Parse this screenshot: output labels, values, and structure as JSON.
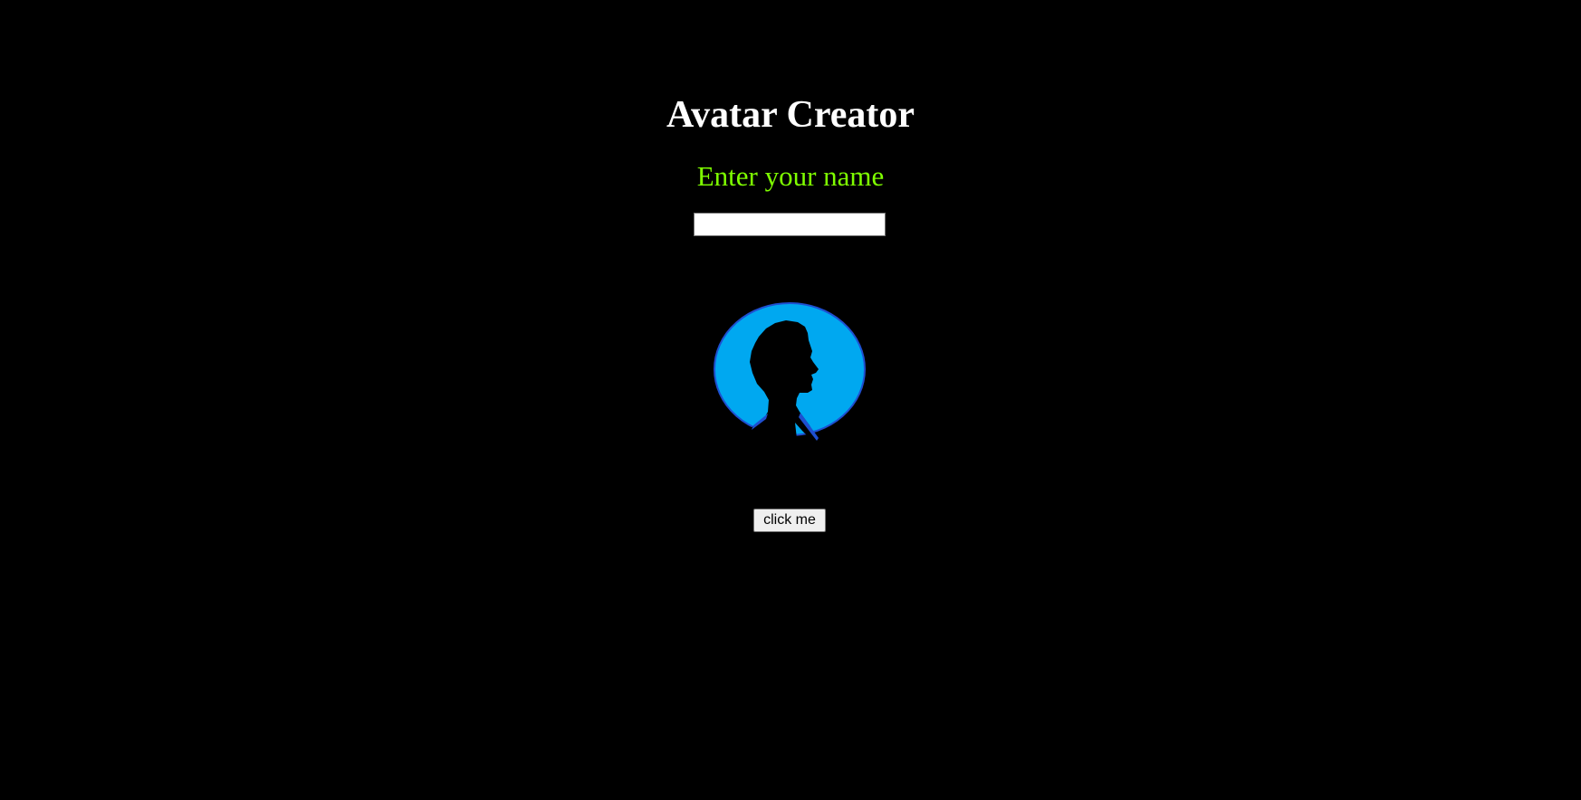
{
  "header": {
    "title": "Avatar Creator",
    "prompt": "Enter your name"
  },
  "name_input": {
    "value": "",
    "placeholder": ""
  },
  "avatar": {
    "icon": "person-silhouette-icon",
    "background_color": "#00a8f0",
    "silhouette_color": "#000000"
  },
  "actions": {
    "button_label": "click me"
  },
  "colors": {
    "page_background": "#000000",
    "title": "#ffffff",
    "prompt": "#7fff00"
  }
}
